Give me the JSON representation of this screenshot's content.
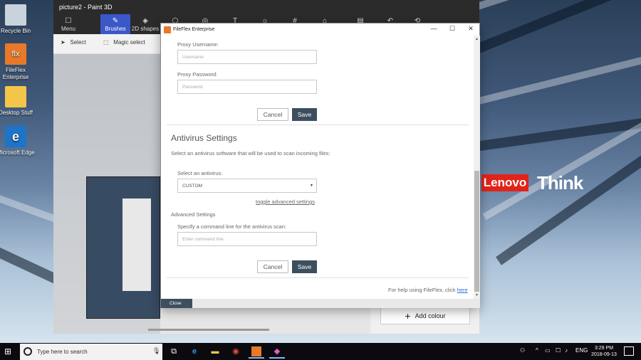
{
  "desktop": {
    "icons": [
      {
        "label": "Recycle Bin",
        "icon": "recycle-bin-icon",
        "color": "#c9d3dd"
      },
      {
        "label": "FileFlex Enterprise",
        "icon": "fileflex-icon",
        "color": "#e8792a"
      },
      {
        "label": "Desktop Stuff",
        "icon": "folder-icon",
        "color": "#f3c64a"
      },
      {
        "label": "Microsoft Edge",
        "icon": "edge-icon",
        "color": "#1e74c8"
      }
    ],
    "brand_lenovo": "Lenovo",
    "brand_think": "Think"
  },
  "paint": {
    "title": "picture2 - Paint 3D",
    "menu": "Menu",
    "ribbon": [
      {
        "label": "Brushes",
        "active": true
      },
      {
        "label": "2D shapes",
        "active": false
      }
    ],
    "tools": {
      "select": "Select",
      "magic_select": "Magic select"
    },
    "add_colour": "Add colour"
  },
  "fileflex": {
    "window_title": "FileFlex Enterprise",
    "proxy_username_label": "Proxy Username:",
    "proxy_username_placeholder": "Username",
    "proxy_password_label": "Proxy Password:",
    "proxy_password_placeholder": "Password",
    "cancel_label": "Cancel",
    "save_label": "Save",
    "antivirus_title": "Antivirus Settings",
    "antivirus_desc": "Select an antivirus software that will be used to scan incoming files:",
    "antivirus_select_label": "Select an antivirus:",
    "antivirus_selected": "CUSTOM",
    "toggle_advanced": "toggle advanced settings",
    "advanced_title": "Advanced Settings",
    "command_line_label": "Specify a command line for the antivirus scan:",
    "command_line_placeholder": "Enter command line",
    "help_text": "For help using FileFlex, click",
    "help_link": "here",
    "close_label": "Close"
  },
  "taskbar": {
    "search_placeholder": "Type here to search",
    "language": "ENG",
    "time": "3:29 PM",
    "date": "2018-09-13"
  }
}
